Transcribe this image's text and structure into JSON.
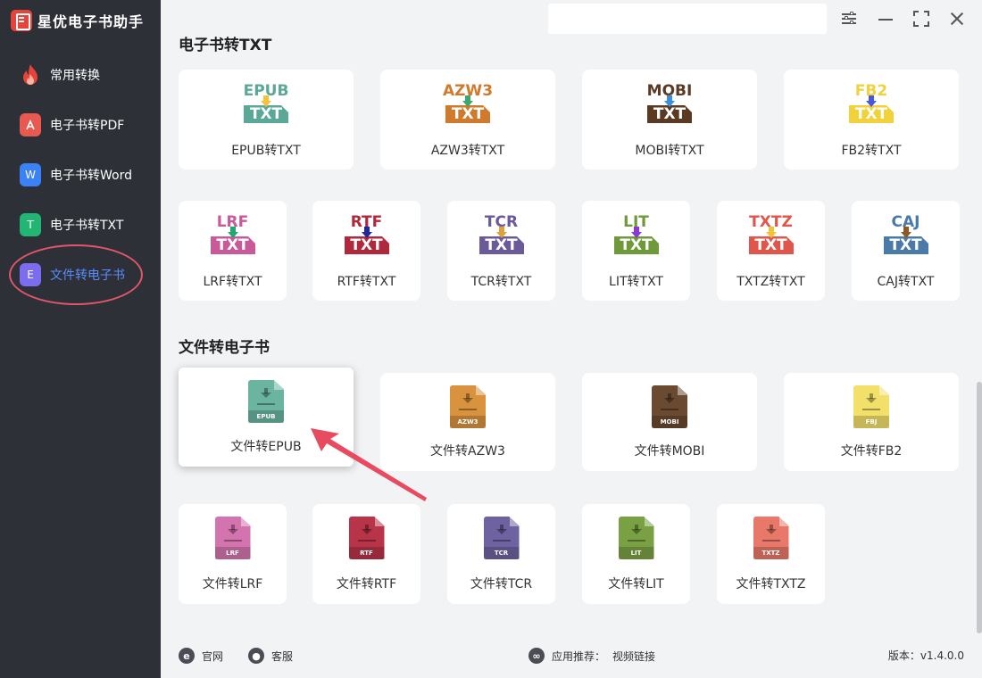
{
  "app": {
    "title": "星优电子书助手"
  },
  "sidebar": {
    "items": [
      {
        "label": "常用转换",
        "icon": "fire-icon",
        "color": "#e8433a",
        "glyph": "🔥"
      },
      {
        "label": "电子书转PDF",
        "icon": "pdf-icon",
        "color": "#e85a4f",
        "glyph": "⅄"
      },
      {
        "label": "电子书转Word",
        "icon": "word-icon",
        "color": "#3b82f6",
        "glyph": "W"
      },
      {
        "label": "电子书转TXT",
        "icon": "txt-icon",
        "color": "#22b573",
        "glyph": "T"
      },
      {
        "label": "文件转电子书",
        "icon": "ebook-icon",
        "color": "#7c6cf0",
        "glyph": "E",
        "active": true
      }
    ]
  },
  "sections": {
    "ebook_to_txt": {
      "title": "电子书转TXT"
    },
    "file_to_ebook": {
      "title": "文件转电子书"
    }
  },
  "to_txt_cards": [
    {
      "format": "EPUB",
      "label": "EPUB转TXT",
      "fmt_color": "#5aa897",
      "arrow_color": "#f2c43a",
      "box_color": "#5aa897"
    },
    {
      "format": "AZW3",
      "label": "AZW3转TXT",
      "fmt_color": "#cf7a2c",
      "arrow_color": "#3aa86e",
      "box_color": "#cf7a2c"
    },
    {
      "format": "MOBI",
      "label": "MOBI转TXT",
      "fmt_color": "#5a3a22",
      "arrow_color": "#3a8fe0",
      "box_color": "#5a3a22"
    },
    {
      "format": "FB2",
      "label": "FB2转TXT",
      "fmt_color": "#f2d23a",
      "arrow_color": "#4a56e0",
      "box_color": "#f2d23a"
    },
    {
      "format": "LRF",
      "label": "LRF转TXT",
      "fmt_color": "#c85a9a",
      "arrow_color": "#22a86e",
      "box_color": "#c85a9a"
    },
    {
      "format": "RTF",
      "label": "RTF转TXT",
      "fmt_color": "#b0283c",
      "arrow_color": "#22289a",
      "box_color": "#b0283c"
    },
    {
      "format": "TCR",
      "label": "TCR转TXT",
      "fmt_color": "#6a5a9a",
      "arrow_color": "#e0a03a",
      "box_color": "#6a5a9a"
    },
    {
      "format": "LIT",
      "label": "LIT转TXT",
      "fmt_color": "#6e9a3a",
      "arrow_color": "#8a3ad0",
      "box_color": "#6e9a3a"
    },
    {
      "format": "TXTZ",
      "label": "TXTZ转TXT",
      "fmt_color": "#e0564a",
      "arrow_color": "#f2c43a",
      "box_color": "#e0564a"
    },
    {
      "format": "CAJ",
      "label": "CAJ转TXT",
      "fmt_color": "#4a7aa8",
      "arrow_color": "#8a5a22",
      "box_color": "#4a7aa8"
    }
  ],
  "to_ebook_cards": [
    {
      "format": "EPUB",
      "label": "文件转EPUB",
      "color": "#6ab4a0"
    },
    {
      "format": "AZW3",
      "label": "文件转AZW3",
      "color": "#d9923e"
    },
    {
      "format": "MOBI",
      "label": "文件转MOBI",
      "color": "#6a4a30"
    },
    {
      "format": "FBJ",
      "label": "文件转FB2",
      "color": "#f2e06a"
    },
    {
      "format": "LRF",
      "label": "文件转LRF",
      "color": "#d474ae"
    },
    {
      "format": "RTF",
      "label": "文件转RTF",
      "color": "#b83448"
    },
    {
      "format": "TCR",
      "label": "文件转TCR",
      "color": "#6e62a0"
    },
    {
      "format": "LIT",
      "label": "文件转LIT",
      "color": "#7aa044"
    },
    {
      "format": "TXTZ",
      "label": "文件转TXTZ",
      "color": "#e8786a"
    }
  ],
  "footer": {
    "website_label": "官网",
    "support_label": "客服",
    "recommend_label": "应用推荐：",
    "recommend_link": "视频链接",
    "version": "版本：v1.4.0.0"
  },
  "colors": {
    "sidebar_bg": "#2d3037",
    "active_text": "#5b8cff",
    "highlight_ring": "#e2566b",
    "pointer_arrow": "#e84a5f"
  }
}
